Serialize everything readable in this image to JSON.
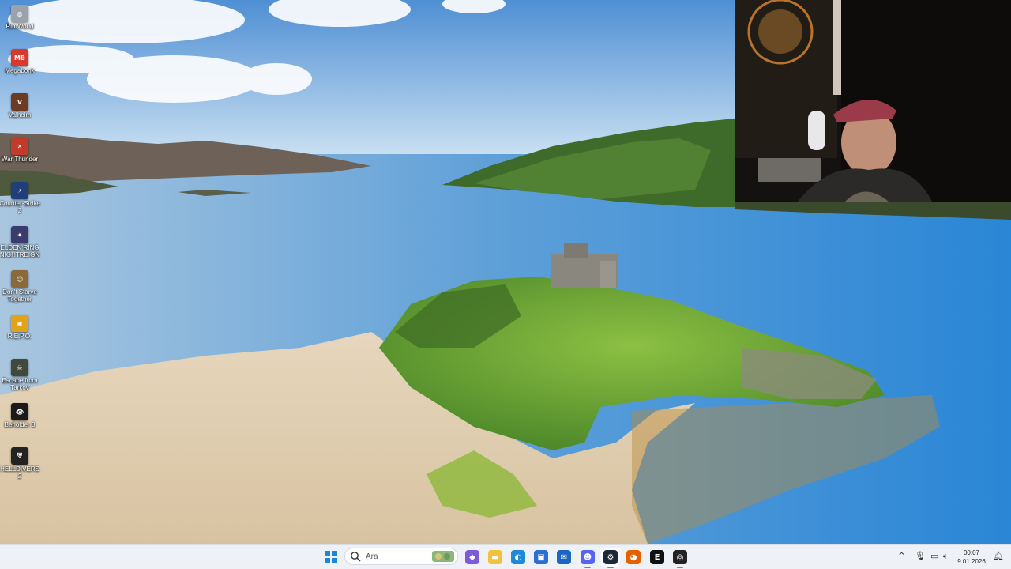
{
  "desktop": {
    "icons": [
      {
        "label": "RimWorld",
        "icon": "rimworld-icon",
        "color": "#9aa3ad",
        "glyph": "◍"
      },
      {
        "label": "Megabonk",
        "icon": "megabonk-icon",
        "color": "#d8392b",
        "glyph": "MB"
      },
      {
        "label": "Valheim",
        "icon": "valheim-icon",
        "color": "#6b3b22",
        "glyph": "V"
      },
      {
        "label": "War Thunder",
        "icon": "war-thunder-icon",
        "color": "#c23a2a",
        "glyph": "✕"
      },
      {
        "label": "Counter-Strike\n2",
        "icon": "counter-strike-icon",
        "color": "#1f3f7a",
        "glyph": "⚡"
      },
      {
        "label": "ELDEN RING\nNIGHTREIGN",
        "icon": "elden-ring-icon",
        "color": "#3a3c6e",
        "glyph": "✦"
      },
      {
        "label": "Don't Starve\nTogether",
        "icon": "dont-starve-icon",
        "color": "#8a6a3a",
        "glyph": "☺"
      },
      {
        "label": "R.E.P.O.",
        "icon": "repo-icon",
        "color": "#e2a21a",
        "glyph": "◉"
      },
      {
        "label": "Escape from\nTarkov",
        "icon": "tarkov-icon",
        "color": "#3f4a3a",
        "glyph": "☠"
      },
      {
        "label": "Beholder 3",
        "icon": "beholder-icon",
        "color": "#1a1a1a",
        "glyph": "👁"
      },
      {
        "label": "HELLDIVERS\n2",
        "icon": "helldivers-icon",
        "color": "#222222",
        "glyph": "⛨"
      }
    ]
  },
  "taskbar": {
    "search_placeholder": "Ara",
    "pinned": [
      {
        "name": "copilot-app-icon",
        "color": "#7b5cd6",
        "glyph": "◆"
      },
      {
        "name": "file-explorer-icon",
        "color": "#f3c23c",
        "glyph": "▬"
      },
      {
        "name": "edge-browser-icon",
        "color": "#1e8ad6",
        "glyph": "◐"
      },
      {
        "name": "store-app-icon",
        "color": "#2a6fd1",
        "glyph": "▣"
      },
      {
        "name": "outlook-app-icon",
        "color": "#1a66c2",
        "glyph": "✉"
      },
      {
        "name": "discord-app-icon",
        "color": "#5865f2",
        "glyph": "☻"
      },
      {
        "name": "steam-app-icon",
        "color": "#1b2838",
        "glyph": "⚙"
      },
      {
        "name": "firefox-app-icon",
        "color": "#e66000",
        "glyph": "◕"
      },
      {
        "name": "epic-games-icon",
        "color": "#111111",
        "glyph": "E"
      },
      {
        "name": "obs-app-icon",
        "color": "#222222",
        "glyph": "◎"
      }
    ],
    "clock_time": "00:07",
    "clock_date": "9.01.2026"
  },
  "colors": {
    "taskbar_bg": "#eef1f6",
    "windows_logo": "#1c86d9"
  }
}
